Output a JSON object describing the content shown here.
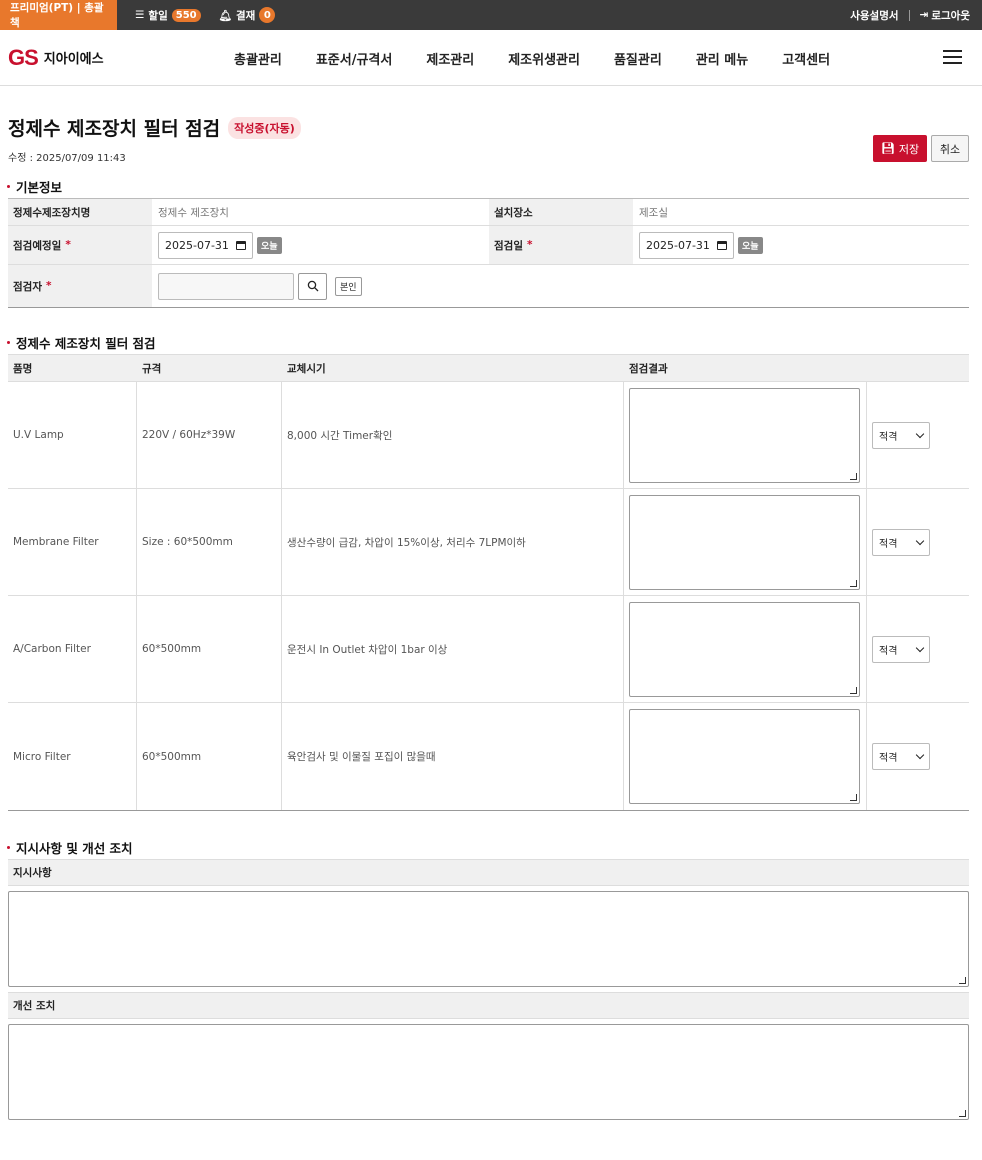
{
  "topbar": {
    "plan": "프리미엄(PT) | 총괄책",
    "todo_label": "할일",
    "todo_count": "550",
    "approval_label": "결재",
    "approval_count": "0",
    "manual": "사용설명서",
    "logout": "로그아웃"
  },
  "header": {
    "logo_gs": "GS",
    "logo_name": "지아이에스",
    "nav": [
      "총괄관리",
      "표준서/규격서",
      "제조관리",
      "제조위생관리",
      "품질관리",
      "관리 메뉴",
      "고객센터"
    ]
  },
  "page": {
    "title": "정제수 제조장치 필터 점검",
    "status": "작성중(자동)",
    "modified": "수정 : 2025/07/09 11:43",
    "save_label": "저장",
    "cancel_label": "취소"
  },
  "basic": {
    "section_title": "기본정보",
    "device_label": "정제수제조장치명",
    "device_value": "정제수 제조장치",
    "location_label": "설치장소",
    "location_value": "제조실",
    "planned_date_label": "점검예정일",
    "planned_date_value": "2025-07-31",
    "inspect_date_label": "점검일",
    "inspect_date_value": "2025-07-31",
    "today_label": "오늘",
    "inspector_label": "점검자",
    "inspector_value": "",
    "self_label": "본인",
    "required_mark": "*"
  },
  "inspection": {
    "section_title": "정제수 제조장치 필터 점검",
    "headers": [
      "품명",
      "규격",
      "교체시기",
      "점검결과"
    ],
    "rows": [
      {
        "name": "U.V Lamp",
        "spec": "220V / 60Hz*39W",
        "cycle": "8,000 시간 Timer확인",
        "result": "적격"
      },
      {
        "name": "Membrane Filter",
        "spec": "Size : 60*500mm",
        "cycle": "생산수량이 급감, 차압이 15%이상, 처리수 7LPM이하",
        "result": "적격"
      },
      {
        "name": "A/Carbon Filter",
        "spec": "60*500mm",
        "cycle": "운전시 In Outlet 차압이 1bar 이상",
        "result": "적격"
      },
      {
        "name": "Micro Filter",
        "spec": "60*500mm",
        "cycle": "육안검사 및 이물질 포집이 많을때",
        "result": "적격"
      }
    ]
  },
  "actions": {
    "section_title": "지시사항 및 개선 조치",
    "instructions_label": "지시사항",
    "improvement_label": "개선 조치"
  }
}
